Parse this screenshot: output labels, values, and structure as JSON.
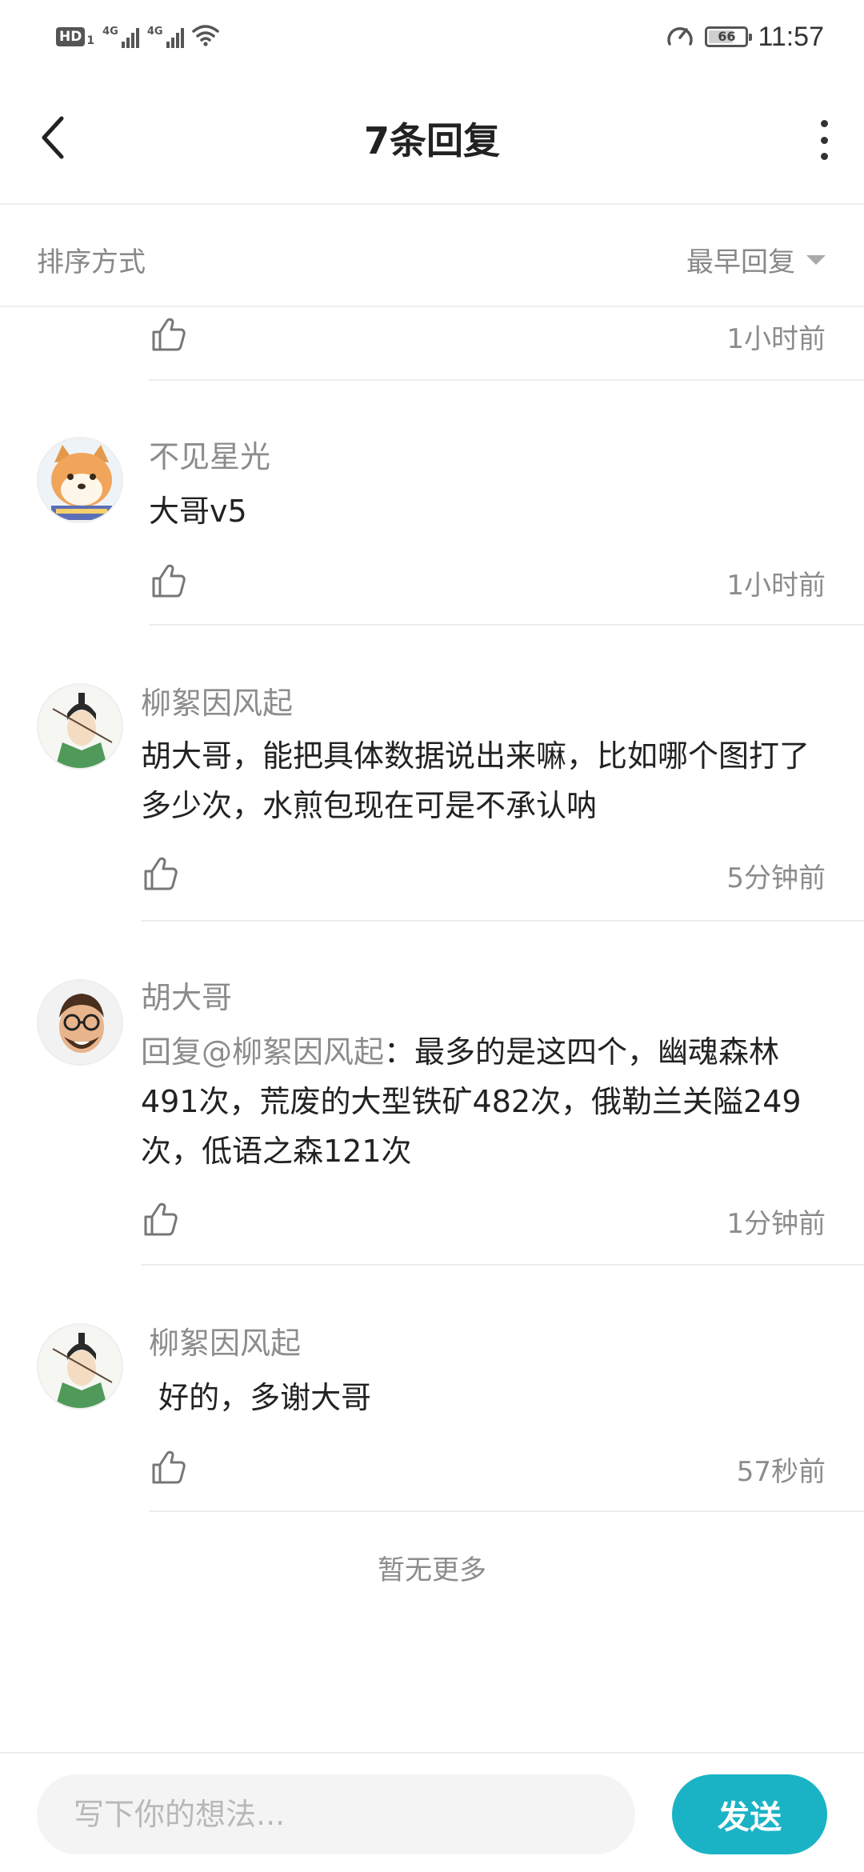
{
  "status_bar": {
    "hd_label": "HD",
    "hd_sub": "1",
    "net1": "4G",
    "net2": "4G",
    "battery": "66",
    "time": "11:57"
  },
  "header": {
    "title": "7条回复"
  },
  "sort": {
    "label": "排序方式",
    "selected": "最早回复"
  },
  "replies": [
    {
      "username": "",
      "content": "",
      "time": "1小时前"
    },
    {
      "username": "不见星光",
      "content": "大哥v5",
      "time": "1小时前"
    },
    {
      "username": "柳絮因风起",
      "content": "胡大哥，能把具体数据说出来嘛，比如哪个图打了多少次，水煎包现在可是不承认呐",
      "time": "5分钟前"
    },
    {
      "username": "胡大哥",
      "mention": "回复@柳絮因风起",
      "content": "：最多的是这四个，幽魂森林491次，荒废的大型铁矿482次，俄勒兰关隘249次，低语之森121次",
      "time": "1分钟前"
    },
    {
      "username": "柳絮因风起",
      "content": " 好的，多谢大哥",
      "time": "57秒前"
    }
  ],
  "footer_note": "暂无更多",
  "composer": {
    "placeholder": "写下你的想法...",
    "send_label": "发送"
  },
  "colors": {
    "accent": "#1ab3c6",
    "muted_text": "#8c8c8c",
    "divider": "#ededed"
  },
  "icons": [
    "back-arrow-icon",
    "more-vertical-icon",
    "caret-down-icon",
    "thumbs-up-icon",
    "wifi-icon",
    "speedometer-icon"
  ]
}
